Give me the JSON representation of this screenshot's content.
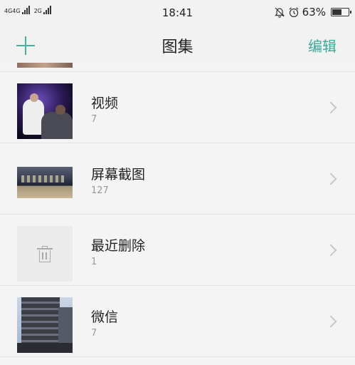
{
  "status_bar": {
    "network_1": "4G",
    "network_1b": "4G",
    "network_2": "2G",
    "time": "18:41",
    "battery_percent": "63%",
    "battery_level": 0.63
  },
  "header": {
    "title": "图集",
    "edit_label": "编辑",
    "add_icon": "plus-icon"
  },
  "albums": [
    {
      "name": "视频",
      "count": "7",
      "thumb": "video-thumbnail"
    },
    {
      "name": "屏幕截图",
      "count": "127",
      "thumb": "screenshot-thumbnail"
    },
    {
      "name": "最近删除",
      "count": "1",
      "thumb": "trash-icon"
    },
    {
      "name": "微信",
      "count": "7",
      "thumb": "wechat-thumbnail"
    }
  ],
  "colors": {
    "accent": "#45b3a2",
    "background": "#f4f4f4"
  }
}
